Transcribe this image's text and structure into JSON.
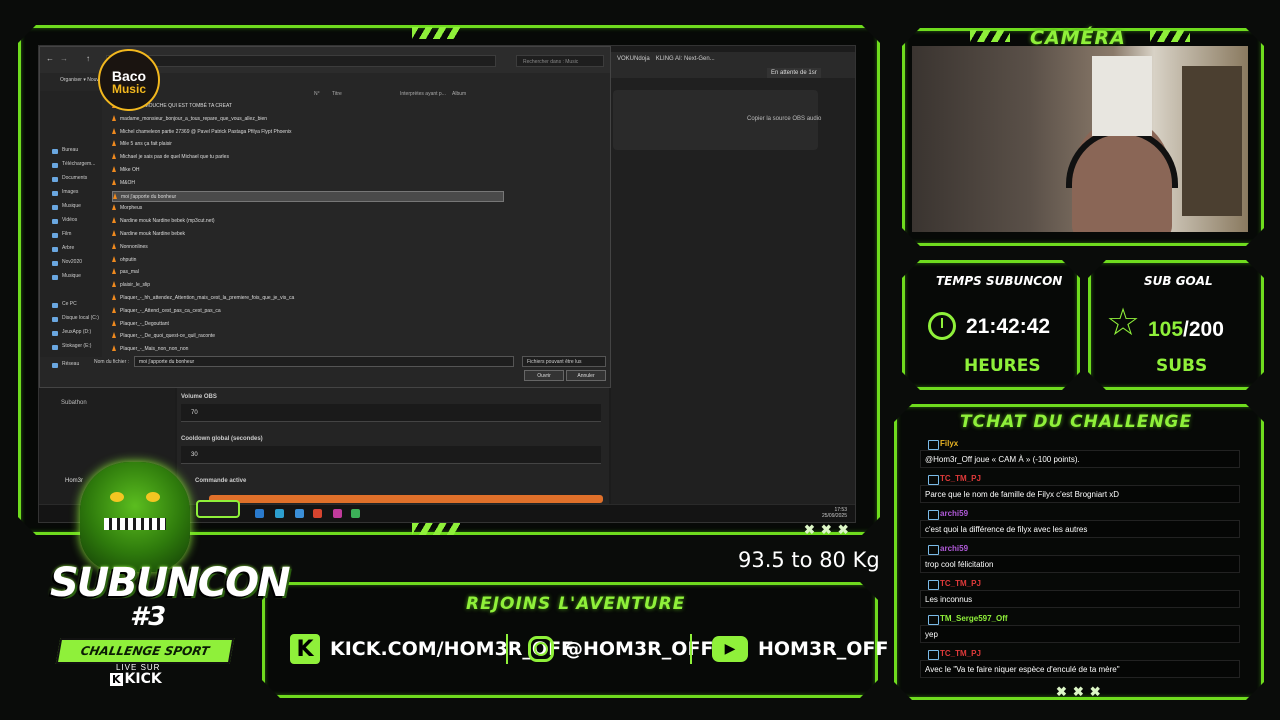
{
  "overlay": {
    "camera_title": "CAMÉRA",
    "timer_title": "TEMPS SUBUNCON",
    "timer_value": "21:42:42",
    "timer_unit": "HEURES",
    "goal_title": "SUB GOAL",
    "goal_current": "105",
    "goal_total": "/200",
    "goal_unit": "SUBS",
    "goal_progress": 0.525,
    "chat_title": "TCHAT DU CHALLENGE",
    "weight_text": "93.5 to 80 Kg",
    "join_title": "REJOINS L'AVENTURE",
    "socials": {
      "kick": "KICK.COM/HOM3R_OFF",
      "instagram": "@HOM3R_OFF",
      "youtube": "HOM3R_OFF"
    },
    "logo": {
      "name": "SUBUNCON",
      "number": "#3",
      "band": "CHALLENGE SPORT",
      "live": "LIVE SUR",
      "platform": "KICK"
    },
    "accent": "#8ff03a"
  },
  "chat": [
    {
      "name": "Filyx",
      "name_color": "#e8b423",
      "message": "@Hom3r_Off joue « CAM À » (-100 points)."
    },
    {
      "name": "TC_TM_PJ",
      "name_color": "#e03a3a",
      "message": "Parce que le nom de famille de Filyx c'est Brogniart xD"
    },
    {
      "name": "archi59",
      "name_color": "#b05ad8",
      "message": "c'est quoi la différence de filyx avec les autres"
    },
    {
      "name": "archi59",
      "name_color": "#b05ad8",
      "message": "trop cool félicitation"
    },
    {
      "name": "TC_TM_PJ",
      "name_color": "#e03a3a",
      "message": "Les inconnus"
    },
    {
      "name": "TM_Serge597_Off",
      "name_color": "#8ff03a",
      "message": "yep"
    },
    {
      "name": "TC_TM_PJ",
      "name_color": "#e03a3a",
      "message": "Avec le \"Va te faire niquer espèce d'enculé de ta mère\""
    }
  ],
  "screen": {
    "baco_line1": "Baco",
    "baco_line2": "Music",
    "address": "Bureau › Music",
    "search_placeholder": "Rechercher dans : Music",
    "toolbar": "Organiser ▾   Nouveau dossier",
    "columns": [
      "N°",
      "Titre",
      "Interprètes ayant p...",
      "Album"
    ],
    "nav_items": [
      "Bureau",
      "Téléchargem...",
      "Documents",
      "Images",
      "Musique",
      "Vidéos",
      "Film",
      "Arbre",
      "Nov2020",
      "Musique",
      "Ce PC",
      "Disque local (C:)",
      "JeuxApp (D:)",
      "Stokager (E:)",
      "Réseau"
    ],
    "files": [
      "MERIS LA MOUCHE QUI EST TOMBÉ TA CREAT",
      "madame_monsieur_bonjour_a_tous_repare_que_vous_allez_bien",
      "Michel chameleon partie 27369 @ Pavel Patrick Pastaga Pfilya Flypt Phoenix",
      "Mile 5 ans ça fait plaisir",
      "Michael je sais pas de quel Michael que tu parles",
      "Mike OH",
      "M&OH",
      "moi j'apporte du bonheur",
      "Morpheus",
      "Nardine mouk Nardine bebek (mp3cut.net)",
      "Nardine mouk Nardine bebek",
      "Nonnonlines",
      "ohputin",
      "pas_mal",
      "plaisir_le_slip",
      "Plaquer_-_hh_attendez_Attention_mais_cest_la_premiere_fois_que_je_vis_ca",
      "Plaquer_-_Attend_cest_pas_ca_cest_pas_ca",
      "Plaquer_-_Degouttant",
      "Plaquer_-_De_quoi_quest-ce_quil_raconte",
      "Plaquer_-_Mais_non_non_non"
    ],
    "selected_index": 7,
    "filename_label": "Nom du fichier :",
    "filename_value": "moi j'apporte du bonheur",
    "filetype": "Fichiers pouvant être lus",
    "open_btn": "Ouvrir",
    "cancel_btn": "Annuler",
    "tabs": [
      "VOKUNdoja",
      "KLING AI: Next-Gen..."
    ],
    "waiting": "En attente de 1sr",
    "copy_source": "Copier la source OBS audio",
    "subathon": "Subathon",
    "homer": "Hom3r",
    "volume_label": "Volume OBS",
    "volume_value": "70",
    "cooldown_label": "Cooldown global (secondes)",
    "cooldown_value": "30",
    "command_label": "Commande active",
    "tray_time": "17:53",
    "tray_date": "25/09/2025"
  }
}
